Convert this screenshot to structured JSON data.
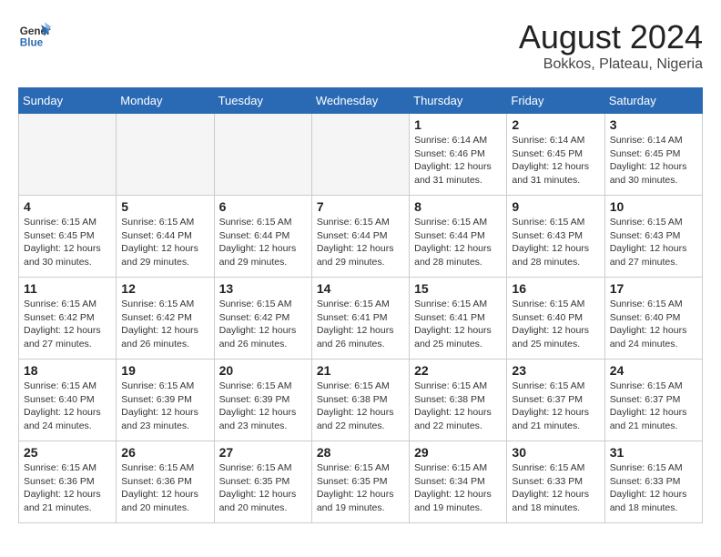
{
  "header": {
    "logo_line1": "General",
    "logo_line2": "Blue",
    "month_title": "August 2024",
    "subtitle": "Bokkos, Plateau, Nigeria"
  },
  "weekdays": [
    "Sunday",
    "Monday",
    "Tuesday",
    "Wednesday",
    "Thursday",
    "Friday",
    "Saturday"
  ],
  "weeks": [
    [
      {
        "day": "",
        "info": ""
      },
      {
        "day": "",
        "info": ""
      },
      {
        "day": "",
        "info": ""
      },
      {
        "day": "",
        "info": ""
      },
      {
        "day": "1",
        "info": "Sunrise: 6:14 AM\nSunset: 6:46 PM\nDaylight: 12 hours\nand 31 minutes."
      },
      {
        "day": "2",
        "info": "Sunrise: 6:14 AM\nSunset: 6:45 PM\nDaylight: 12 hours\nand 31 minutes."
      },
      {
        "day": "3",
        "info": "Sunrise: 6:14 AM\nSunset: 6:45 PM\nDaylight: 12 hours\nand 30 minutes."
      }
    ],
    [
      {
        "day": "4",
        "info": "Sunrise: 6:15 AM\nSunset: 6:45 PM\nDaylight: 12 hours\nand 30 minutes."
      },
      {
        "day": "5",
        "info": "Sunrise: 6:15 AM\nSunset: 6:44 PM\nDaylight: 12 hours\nand 29 minutes."
      },
      {
        "day": "6",
        "info": "Sunrise: 6:15 AM\nSunset: 6:44 PM\nDaylight: 12 hours\nand 29 minutes."
      },
      {
        "day": "7",
        "info": "Sunrise: 6:15 AM\nSunset: 6:44 PM\nDaylight: 12 hours\nand 29 minutes."
      },
      {
        "day": "8",
        "info": "Sunrise: 6:15 AM\nSunset: 6:44 PM\nDaylight: 12 hours\nand 28 minutes."
      },
      {
        "day": "9",
        "info": "Sunrise: 6:15 AM\nSunset: 6:43 PM\nDaylight: 12 hours\nand 28 minutes."
      },
      {
        "day": "10",
        "info": "Sunrise: 6:15 AM\nSunset: 6:43 PM\nDaylight: 12 hours\nand 27 minutes."
      }
    ],
    [
      {
        "day": "11",
        "info": "Sunrise: 6:15 AM\nSunset: 6:42 PM\nDaylight: 12 hours\nand 27 minutes."
      },
      {
        "day": "12",
        "info": "Sunrise: 6:15 AM\nSunset: 6:42 PM\nDaylight: 12 hours\nand 26 minutes."
      },
      {
        "day": "13",
        "info": "Sunrise: 6:15 AM\nSunset: 6:42 PM\nDaylight: 12 hours\nand 26 minutes."
      },
      {
        "day": "14",
        "info": "Sunrise: 6:15 AM\nSunset: 6:41 PM\nDaylight: 12 hours\nand 26 minutes."
      },
      {
        "day": "15",
        "info": "Sunrise: 6:15 AM\nSunset: 6:41 PM\nDaylight: 12 hours\nand 25 minutes."
      },
      {
        "day": "16",
        "info": "Sunrise: 6:15 AM\nSunset: 6:40 PM\nDaylight: 12 hours\nand 25 minutes."
      },
      {
        "day": "17",
        "info": "Sunrise: 6:15 AM\nSunset: 6:40 PM\nDaylight: 12 hours\nand 24 minutes."
      }
    ],
    [
      {
        "day": "18",
        "info": "Sunrise: 6:15 AM\nSunset: 6:40 PM\nDaylight: 12 hours\nand 24 minutes."
      },
      {
        "day": "19",
        "info": "Sunrise: 6:15 AM\nSunset: 6:39 PM\nDaylight: 12 hours\nand 23 minutes."
      },
      {
        "day": "20",
        "info": "Sunrise: 6:15 AM\nSunset: 6:39 PM\nDaylight: 12 hours\nand 23 minutes."
      },
      {
        "day": "21",
        "info": "Sunrise: 6:15 AM\nSunset: 6:38 PM\nDaylight: 12 hours\nand 22 minutes."
      },
      {
        "day": "22",
        "info": "Sunrise: 6:15 AM\nSunset: 6:38 PM\nDaylight: 12 hours\nand 22 minutes."
      },
      {
        "day": "23",
        "info": "Sunrise: 6:15 AM\nSunset: 6:37 PM\nDaylight: 12 hours\nand 21 minutes."
      },
      {
        "day": "24",
        "info": "Sunrise: 6:15 AM\nSunset: 6:37 PM\nDaylight: 12 hours\nand 21 minutes."
      }
    ],
    [
      {
        "day": "25",
        "info": "Sunrise: 6:15 AM\nSunset: 6:36 PM\nDaylight: 12 hours\nand 21 minutes."
      },
      {
        "day": "26",
        "info": "Sunrise: 6:15 AM\nSunset: 6:36 PM\nDaylight: 12 hours\nand 20 minutes."
      },
      {
        "day": "27",
        "info": "Sunrise: 6:15 AM\nSunset: 6:35 PM\nDaylight: 12 hours\nand 20 minutes."
      },
      {
        "day": "28",
        "info": "Sunrise: 6:15 AM\nSunset: 6:35 PM\nDaylight: 12 hours\nand 19 minutes."
      },
      {
        "day": "29",
        "info": "Sunrise: 6:15 AM\nSunset: 6:34 PM\nDaylight: 12 hours\nand 19 minutes."
      },
      {
        "day": "30",
        "info": "Sunrise: 6:15 AM\nSunset: 6:33 PM\nDaylight: 12 hours\nand 18 minutes."
      },
      {
        "day": "31",
        "info": "Sunrise: 6:15 AM\nSunset: 6:33 PM\nDaylight: 12 hours\nand 18 minutes."
      }
    ]
  ]
}
